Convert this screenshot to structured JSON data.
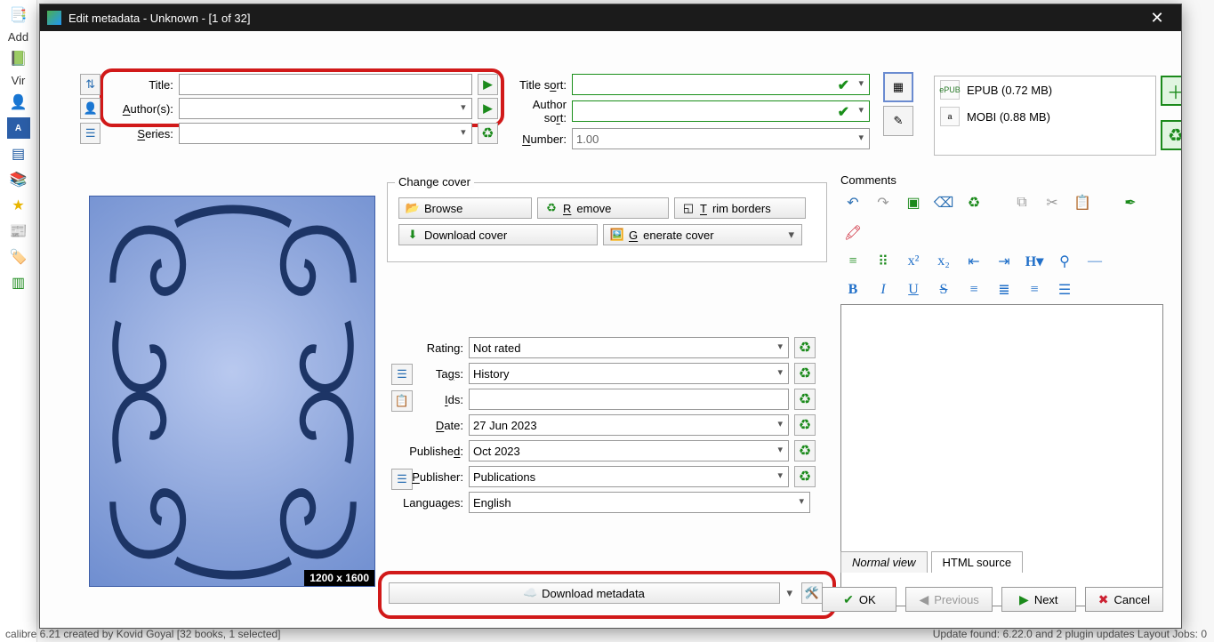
{
  "window_title": "Edit metadata - Unknown -  [1 of 32]",
  "header": {
    "title_label": "Title:",
    "authors_label": "Author(s):",
    "series_label": "Series:",
    "title_sort_label": "Title sort:",
    "author_sort_label": "Author sort:",
    "number_label": "Number:",
    "number_value": "1.00"
  },
  "cover_group": {
    "title": "Change cover",
    "browse": "Browse",
    "remove": "Remove",
    "trim": "Trim borders",
    "download": "Download cover",
    "generate": "Generate cover",
    "dimensions": "1200 x 1600"
  },
  "meta": {
    "rating_label": "Rating:",
    "rating_value": "Not rated",
    "tags_label": "Tags:",
    "tags_value": "History",
    "ids_label": "Ids:",
    "ids_value": "",
    "date_label": "Date:",
    "date_value": "27 Jun 2023",
    "published_label": "Published:",
    "published_value": "Oct 2023",
    "publisher_label": "Publisher:",
    "publisher_value": "Publications",
    "languages_label": "Languages:",
    "languages_value": "English"
  },
  "download_metadata_label": "Download metadata",
  "comments": {
    "title": "Comments",
    "normal_view": "Normal view",
    "html_source": "HTML source"
  },
  "formats": {
    "epub": "EPUB (0.72 MB)",
    "mobi": "MOBI (0.88 MB)"
  },
  "dialog_buttons": {
    "ok": "OK",
    "previous": "Previous",
    "next": "Next",
    "cancel": "Cancel"
  },
  "background": {
    "add": "Add",
    "vir": "Vir",
    "status": "calibre 6.21 created by Kovid Goyal  [32 books, 1 selected]",
    "status_right": "Update found: 6.22.0 and 2 plugin updates    Layout    Jobs: 0"
  }
}
